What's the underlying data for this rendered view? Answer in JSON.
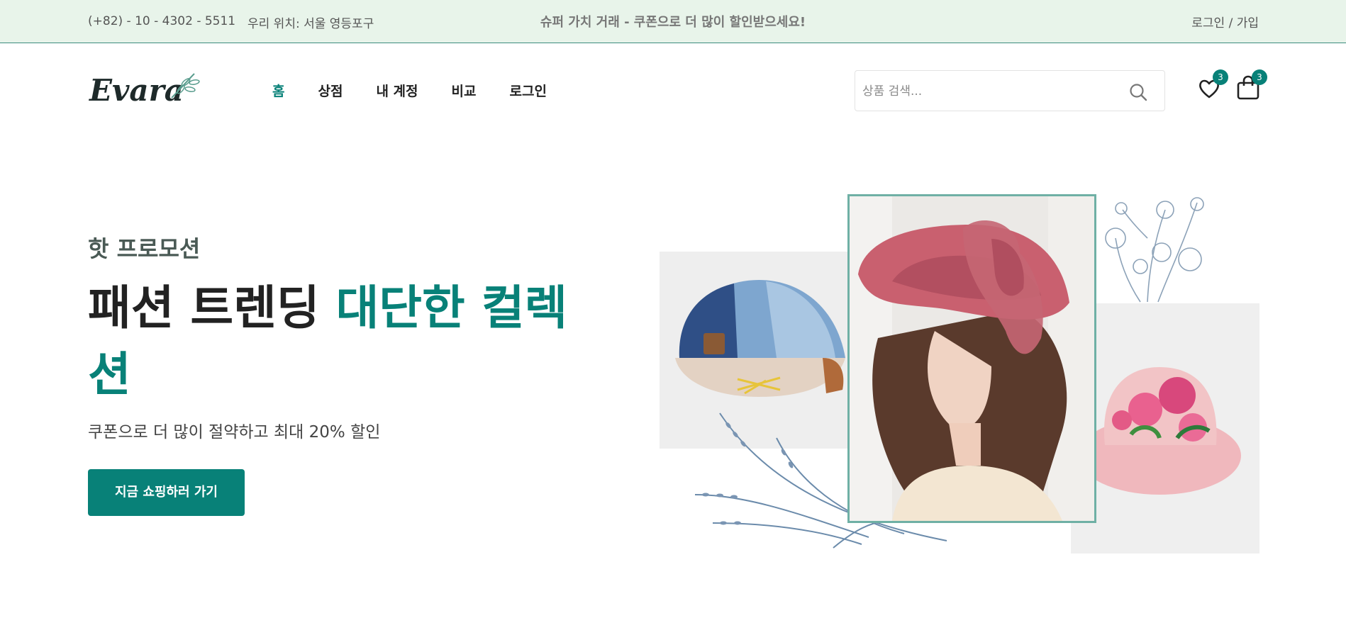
{
  "topbar": {
    "phone": "(+82) - 10 - 4302 - 5511",
    "location": "우리 위치: 서울 영등포구",
    "promo": "슈퍼 가치 거래 - 쿠폰으로 더 많이 할인받으세요!",
    "auth": "로그인 / 가입"
  },
  "header": {
    "logo_text": "Evara",
    "nav": [
      "홈",
      "상점",
      "내 계정",
      "비교",
      "로그인"
    ],
    "search_placeholder": "상품 검색...",
    "wishlist_count": "3",
    "cart_count": "3"
  },
  "hero": {
    "subtitle": "핫 프로모션",
    "headline_plain": "패션 트렌딩 ",
    "headline_accent": "대단한 컬렉션",
    "description": "쿠폰으로 더 많이 절약하고 최대 20% 할인",
    "cta_label": "지금 쇼핑하러 가기"
  },
  "colors": {
    "accent": "#088178",
    "topbar_bg": "#e8f4ea",
    "frame": "#6fb0a5"
  },
  "icons": {
    "search": "search-icon",
    "wishlist": "heart-icon",
    "cart": "shopping-bag-icon"
  }
}
